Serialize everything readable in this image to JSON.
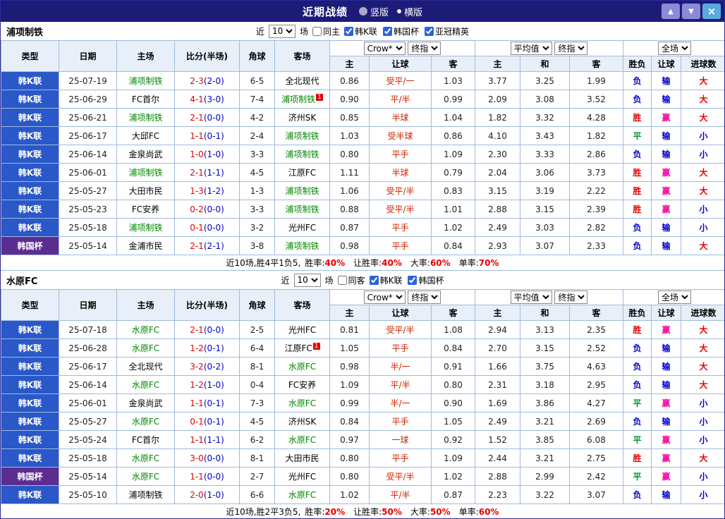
{
  "titlebar": {
    "title": "近期战绩",
    "layout_options": [
      {
        "label": "竖版",
        "selected": false
      },
      {
        "label": "横版",
        "selected": true
      }
    ],
    "buttons": {
      "up": "▲",
      "down": "▼",
      "close": "×"
    }
  },
  "filter": {
    "near": "近",
    "count": "10",
    "games": "场"
  },
  "controls": {
    "bookmaker": "Crow*",
    "final_a": "终指",
    "average": "平均值",
    "final_b": "终指",
    "scope": "全场"
  },
  "headers": {
    "type": "类型",
    "date": "日期",
    "home": "主场",
    "score": "比分(半场)",
    "corner": "角球",
    "away": "客场",
    "odds_home": "主",
    "odds_hcp": "让球",
    "odds_away": "客",
    "avg_home": "主",
    "avg_draw": "和",
    "avg_away": "客",
    "result_wdl": "胜负",
    "result_hcp": "让球",
    "result_goals": "进球数"
  },
  "colors": {
    "league_k": "#2a58c8",
    "league_cup": "#5c2d91",
    "self_team": "#008800",
    "other_team": "#000000",
    "score_ft": "#e60000",
    "score_ht": "#0000cc",
    "handicap": "#cc2200",
    "win": "#e60000",
    "draw": "#009933",
    "loss": "#0000cc",
    "cover": "#f312a6",
    "big": "#e60000",
    "small": "#0000cc",
    "stat_value": "#e60000"
  },
  "result_color_keys": {
    "胜": "win",
    "平": "draw",
    "负": "loss",
    "赢": "cover",
    "输": "loss",
    "大": "big",
    "小": "small"
  },
  "sections": [
    {
      "team": "浦项制铁",
      "same_label": "同主",
      "same_checked": false,
      "leagues": [
        {
          "label": "韩K联",
          "checked": true
        },
        {
          "label": "韩国杯",
          "checked": true
        },
        {
          "label": "亚冠精英",
          "checked": true
        }
      ],
      "rows": [
        {
          "league": "韩K联",
          "cup": false,
          "date": "25-07-19",
          "home": "浦项制铁",
          "home_self": true,
          "ft": "2-3",
          "ht": "(2-0)",
          "corner": "6-5",
          "away": "全北现代",
          "away_self": false,
          "o1": "0.86",
          "hcp": "受平/一",
          "o2": "1.03",
          "a1": "3.77",
          "a2": "3.25",
          "a3": "1.99",
          "wdl": "负",
          "cov": "输",
          "goals": "大"
        },
        {
          "league": "韩K联",
          "cup": false,
          "date": "25-06-29",
          "home": "FC首尔",
          "home_self": false,
          "ft": "4-1",
          "ht": "(3-0)",
          "corner": "7-4",
          "away": "浦项制铁",
          "away_self": true,
          "away_badge": "1",
          "o1": "0.90",
          "hcp": "平/半",
          "o2": "0.99",
          "a1": "2.09",
          "a2": "3.08",
          "a3": "3.52",
          "wdl": "负",
          "cov": "输",
          "goals": "大"
        },
        {
          "league": "韩K联",
          "cup": false,
          "date": "25-06-21",
          "home": "浦项制铁",
          "home_self": true,
          "ft": "2-1",
          "ht": "(0-0)",
          "corner": "4-2",
          "away": "济州SK",
          "away_self": false,
          "o1": "0.85",
          "hcp": "半球",
          "o2": "1.04",
          "a1": "1.82",
          "a2": "3.32",
          "a3": "4.28",
          "wdl": "胜",
          "cov": "赢",
          "goals": "大"
        },
        {
          "league": "韩K联",
          "cup": false,
          "date": "25-06-17",
          "home": "大邱FC",
          "home_self": false,
          "ft": "1-1",
          "ht": "(0-1)",
          "corner": "2-4",
          "away": "浦项制铁",
          "away_self": true,
          "o1": "1.03",
          "hcp": "受半球",
          "o2": "0.86",
          "a1": "4.10",
          "a2": "3.43",
          "a3": "1.82",
          "wdl": "平",
          "cov": "输",
          "goals": "小"
        },
        {
          "league": "韩K联",
          "cup": false,
          "date": "25-06-14",
          "home": "金泉尚武",
          "home_self": false,
          "ft": "1-0",
          "ht": "(1-0)",
          "corner": "3-3",
          "away": "浦项制铁",
          "away_self": true,
          "o1": "0.80",
          "hcp": "平手",
          "o2": "1.09",
          "a1": "2.30",
          "a2": "3.33",
          "a3": "2.86",
          "wdl": "负",
          "cov": "输",
          "goals": "小"
        },
        {
          "league": "韩K联",
          "cup": false,
          "date": "25-06-01",
          "home": "浦项制铁",
          "home_self": true,
          "ft": "2-1",
          "ht": "(1-1)",
          "corner": "4-5",
          "away": "江原FC",
          "away_self": false,
          "o1": "1.11",
          "hcp": "半球",
          "o2": "0.79",
          "a1": "2.04",
          "a2": "3.06",
          "a3": "3.73",
          "wdl": "胜",
          "cov": "赢",
          "goals": "大"
        },
        {
          "league": "韩K联",
          "cup": false,
          "date": "25-05-27",
          "home": "大田市民",
          "home_self": false,
          "ft": "1-3",
          "ht": "(1-2)",
          "corner": "1-3",
          "away": "浦项制铁",
          "away_self": true,
          "o1": "1.06",
          "hcp": "受平/半",
          "o2": "0.83",
          "a1": "3.15",
          "a2": "3.19",
          "a3": "2.22",
          "wdl": "胜",
          "cov": "赢",
          "goals": "大"
        },
        {
          "league": "韩K联",
          "cup": false,
          "date": "25-05-23",
          "home": "FC安养",
          "home_self": false,
          "ft": "0-2",
          "ht": "(0-0)",
          "corner": "3-3",
          "away": "浦项制铁",
          "away_self": true,
          "o1": "0.88",
          "hcp": "受平/半",
          "o2": "1.01",
          "a1": "2.88",
          "a2": "3.15",
          "a3": "2.39",
          "wdl": "胜",
          "cov": "赢",
          "goals": "小"
        },
        {
          "league": "韩K联",
          "cup": false,
          "date": "25-05-18",
          "home": "浦项制铁",
          "home_self": true,
          "ft": "0-1",
          "ht": "(0-0)",
          "corner": "3-2",
          "away": "光州FC",
          "away_self": false,
          "o1": "0.87",
          "hcp": "平手",
          "o2": "1.02",
          "a1": "2.49",
          "a2": "3.03",
          "a3": "2.82",
          "wdl": "负",
          "cov": "输",
          "goals": "小"
        },
        {
          "league": "韩国杯",
          "cup": true,
          "date": "25-05-14",
          "home": "金浦市民",
          "home_self": false,
          "ft": "2-1",
          "ht": "(2-1)",
          "corner": "3-8",
          "away": "浦项制铁",
          "away_self": true,
          "o1": "0.98",
          "hcp": "平手",
          "o2": "0.84",
          "a1": "2.93",
          "a2": "3.07",
          "a3": "2.33",
          "wdl": "负",
          "cov": "输",
          "goals": "大"
        }
      ],
      "summary": {
        "prefix": "近10场,胜4平1负5,",
        "stats": [
          {
            "label": "胜率:",
            "value": "40%"
          },
          {
            "label": "让胜率:",
            "value": "40%"
          },
          {
            "label": "大率:",
            "value": "60%"
          },
          {
            "label": "单率:",
            "value": "70%"
          }
        ]
      }
    },
    {
      "team": "水原FC",
      "same_label": "同客",
      "same_checked": false,
      "leagues": [
        {
          "label": "韩K联",
          "checked": true
        },
        {
          "label": "韩国杯",
          "checked": true
        }
      ],
      "rows": [
        {
          "league": "韩K联",
          "cup": false,
          "date": "25-07-18",
          "home": "水原FC",
          "home_self": true,
          "ft": "2-1",
          "ht": "(0-0)",
          "corner": "2-5",
          "away": "光州FC",
          "away_self": false,
          "o1": "0.81",
          "hcp": "受平/半",
          "o2": "1.08",
          "a1": "2.94",
          "a2": "3.13",
          "a3": "2.35",
          "wdl": "胜",
          "cov": "赢",
          "goals": "大"
        },
        {
          "league": "韩K联",
          "cup": false,
          "date": "25-06-28",
          "home": "水原FC",
          "home_self": true,
          "ft": "1-2",
          "ht": "(0-1)",
          "corner": "6-4",
          "away": "江原FC",
          "away_self": false,
          "away_badge": "1",
          "o1": "1.05",
          "hcp": "平手",
          "o2": "0.84",
          "a1": "2.70",
          "a2": "3.15",
          "a3": "2.52",
          "wdl": "负",
          "cov": "输",
          "goals": "大"
        },
        {
          "league": "韩K联",
          "cup": false,
          "date": "25-06-17",
          "home": "全北现代",
          "home_self": false,
          "ft": "3-2",
          "ht": "(0-2)",
          "corner": "8-1",
          "away": "水原FC",
          "away_self": true,
          "o1": "0.98",
          "hcp": "半/一",
          "o2": "0.91",
          "a1": "1.66",
          "a2": "3.75",
          "a3": "4.63",
          "wdl": "负",
          "cov": "输",
          "goals": "大"
        },
        {
          "league": "韩K联",
          "cup": false,
          "date": "25-06-14",
          "home": "水原FC",
          "home_self": true,
          "ft": "1-2",
          "ht": "(1-0)",
          "corner": "0-4",
          "away": "FC安养",
          "away_self": false,
          "o1": "1.09",
          "hcp": "平/半",
          "o2": "0.80",
          "a1": "2.31",
          "a2": "3.18",
          "a3": "2.95",
          "wdl": "负",
          "cov": "输",
          "goals": "大"
        },
        {
          "league": "韩K联",
          "cup": false,
          "date": "25-06-01",
          "home": "金泉尚武",
          "home_self": false,
          "ft": "1-1",
          "ht": "(0-1)",
          "corner": "7-3",
          "away": "水原FC",
          "away_self": true,
          "o1": "0.99",
          "hcp": "半/一",
          "o2": "0.90",
          "a1": "1.69",
          "a2": "3.86",
          "a3": "4.27",
          "wdl": "平",
          "cov": "赢",
          "goals": "小"
        },
        {
          "league": "韩K联",
          "cup": false,
          "date": "25-05-27",
          "home": "水原FC",
          "home_self": true,
          "ft": "0-1",
          "ht": "(0-1)",
          "corner": "4-5",
          "away": "济州SK",
          "away_self": false,
          "o1": "0.84",
          "hcp": "平手",
          "o2": "1.05",
          "a1": "2.49",
          "a2": "3.21",
          "a3": "2.69",
          "wdl": "负",
          "cov": "输",
          "goals": "小"
        },
        {
          "league": "韩K联",
          "cup": false,
          "date": "25-05-24",
          "home": "FC首尔",
          "home_self": false,
          "ft": "1-1",
          "ht": "(1-1)",
          "corner": "6-2",
          "away": "水原FC",
          "away_self": true,
          "o1": "0.97",
          "hcp": "一球",
          "o2": "0.92",
          "a1": "1.52",
          "a2": "3.85",
          "a3": "6.08",
          "wdl": "平",
          "cov": "赢",
          "goals": "小"
        },
        {
          "league": "韩K联",
          "cup": false,
          "date": "25-05-18",
          "home": "水原FC",
          "home_self": true,
          "ft": "3-0",
          "ht": "(0-0)",
          "corner": "8-1",
          "away": "大田市民",
          "away_self": false,
          "o1": "0.80",
          "hcp": "平手",
          "o2": "1.09",
          "a1": "2.44",
          "a2": "3.21",
          "a3": "2.75",
          "wdl": "胜",
          "cov": "赢",
          "goals": "大"
        },
        {
          "league": "韩国杯",
          "cup": true,
          "date": "25-05-14",
          "home": "水原FC",
          "home_self": true,
          "ft": "1-1",
          "ht": "(0-0)",
          "corner": "2-7",
          "away": "光州FC",
          "away_self": false,
          "o1": "0.80",
          "hcp": "受平/半",
          "o2": "1.02",
          "a1": "2.88",
          "a2": "2.99",
          "a3": "2.42",
          "wdl": "平",
          "cov": "赢",
          "goals": "小"
        },
        {
          "league": "韩K联",
          "cup": false,
          "date": "25-05-10",
          "home": "浦项制铁",
          "home_self": false,
          "ft": "2-0",
          "ht": "(1-0)",
          "corner": "6-6",
          "away": "水原FC",
          "away_self": true,
          "o1": "1.02",
          "hcp": "平/半",
          "o2": "0.87",
          "a1": "2.23",
          "a2": "3.22",
          "a3": "3.07",
          "wdl": "负",
          "cov": "输",
          "goals": "小"
        }
      ],
      "summary": {
        "prefix": "近10场,胜2平3负5,",
        "stats": [
          {
            "label": "胜率:",
            "value": "20%"
          },
          {
            "label": "让胜率:",
            "value": "50%"
          },
          {
            "label": "大率:",
            "value": "50%"
          },
          {
            "label": "单率:",
            "value": "60%"
          }
        ]
      }
    }
  ]
}
